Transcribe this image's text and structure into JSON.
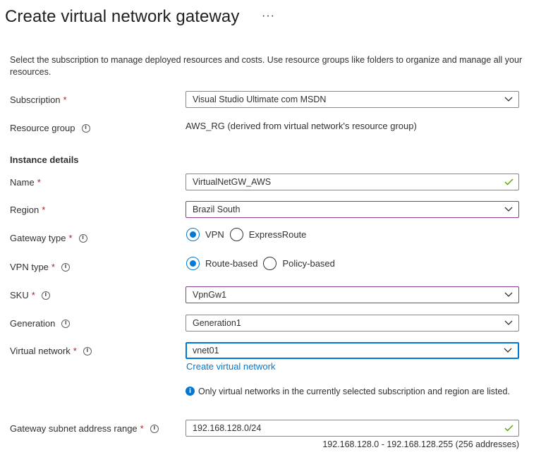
{
  "header": {
    "title": "Create virtual network gateway",
    "more_label": "···"
  },
  "intro_text": "Select the subscription to manage deployed resources and costs. Use resource groups like folders to organize and manage all your resources.",
  "subscription": {
    "label": "Subscription",
    "required": "*",
    "value": "Visual Studio Ultimate com MSDN"
  },
  "resource_group": {
    "label": "Resource group",
    "info": "i",
    "value": "AWS_RG (derived from virtual network's resource group)"
  },
  "instance_details": {
    "title": "Instance details"
  },
  "name": {
    "label": "Name",
    "required": "*",
    "value": "VirtualNetGW_AWS"
  },
  "region": {
    "label": "Region",
    "required": "*",
    "value": "Brazil South"
  },
  "gateway_type": {
    "label": "Gateway type",
    "required": "*",
    "info": "i",
    "options": [
      "VPN",
      "ExpressRoute"
    ],
    "selected": "VPN"
  },
  "vpn_type": {
    "label": "VPN type",
    "required": "*",
    "info": "i",
    "options": [
      "Route-based",
      "Policy-based"
    ],
    "selected": "Route-based"
  },
  "sku": {
    "label": "SKU",
    "required": "*",
    "info": "i",
    "value": "VpnGw1"
  },
  "generation": {
    "label": "Generation",
    "info": "i",
    "value": "Generation1"
  },
  "virtual_network": {
    "label": "Virtual network",
    "required": "*",
    "info": "i",
    "value": "vnet01",
    "create_link": "Create virtual network",
    "note_icon": "i",
    "note": "Only virtual networks in the currently selected subscription and region are listed."
  },
  "gateway_subnet": {
    "label": "Gateway subnet address range",
    "required": "*",
    "info": "i",
    "value": "192.168.128.0/24",
    "range": "192.168.128.0 - 192.168.128.255 (256 addresses)"
  },
  "colors": {
    "accent": "#0078d4",
    "required": "#a4262c",
    "valid_check": "#57a300",
    "region_border": "#8a3d8f"
  }
}
